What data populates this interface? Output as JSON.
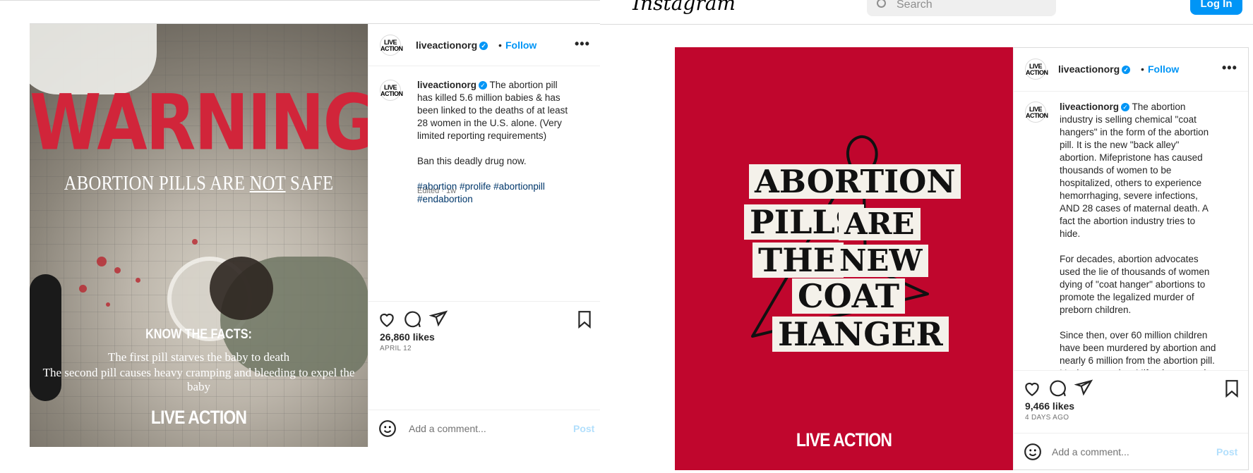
{
  "left_post": {
    "image": {
      "headline": "WARNING",
      "subhead_pre": "ABORTION PILLS ARE ",
      "subhead_emph": "NOT",
      "subhead_post": " SAFE",
      "facts_title": "KNOW THE FACTS:",
      "fact1": "The first pill starves the baby to death",
      "fact2": "The second pill causes heavy cramping and bleeding to expel the baby",
      "brand": "LIVE ACTION"
    },
    "header": {
      "avatar": "LIVE ACTION",
      "username": "liveactionorg",
      "dot": "•",
      "follow": "Follow",
      "more": "•••"
    },
    "caption": {
      "username": "liveactionorg",
      "text": " The abortion pill has killed 5.6 million babies & has been linked to the deaths of at least 28 women in the U.S. alone. (Very limited reporting requirements)\n\nBan this deadly drug now.\n\n",
      "hashtags": "#abortion #prolife #abortionpill\n#endabortion",
      "edited": "Edited · 1w"
    },
    "likes": "26,860 likes",
    "date": "APRIL 12",
    "comment_placeholder": "Add a comment...",
    "post_label": "Post"
  },
  "topbar": {
    "logo": "Instagram",
    "search_placeholder": "Search",
    "login": "Log In"
  },
  "right_post": {
    "image": {
      "line1": "ABORTION",
      "line2a": "PILLS",
      "line2b": "ARE",
      "line3a": "THE",
      "line3b": "NEW",
      "line4": "COAT",
      "line5": "HANGER",
      "brand": "LIVE ACTION"
    },
    "header": {
      "avatar": "LIVE ACTION",
      "username": "liveactionorg",
      "dot": "•",
      "follow": "Follow",
      "more": "•••"
    },
    "caption": {
      "username": "liveactionorg",
      "text": " The abortion industry is selling chemical \"coat hangers\" in the form of the abortion pill. It is the new \"back alley\" abortion. Mifepristone has caused thousands of women to be hospitalized, others to experience hemorrhaging, severe infections, AND 28 cases of maternal death. A fact the abortion industry tries to hide.\n\nFor decades, abortion advocates used the lie of thousands of women dying of \"coat hanger\" abortions to promote the legalized murder of preborn children.\n\nSince then, over 60 million children have been murdered by abortion and nearly 6 million from the abortion pill. It's time to outlaw Mifepristone and"
    },
    "likes": "9,466 likes",
    "date": "4 DAYS AGO",
    "comment_placeholder": "Add a comment...",
    "post_label": "Post"
  },
  "colors": {
    "accent": "#0095f6",
    "red_panel": "#c0062d",
    "warning_red": "#d1253a"
  }
}
